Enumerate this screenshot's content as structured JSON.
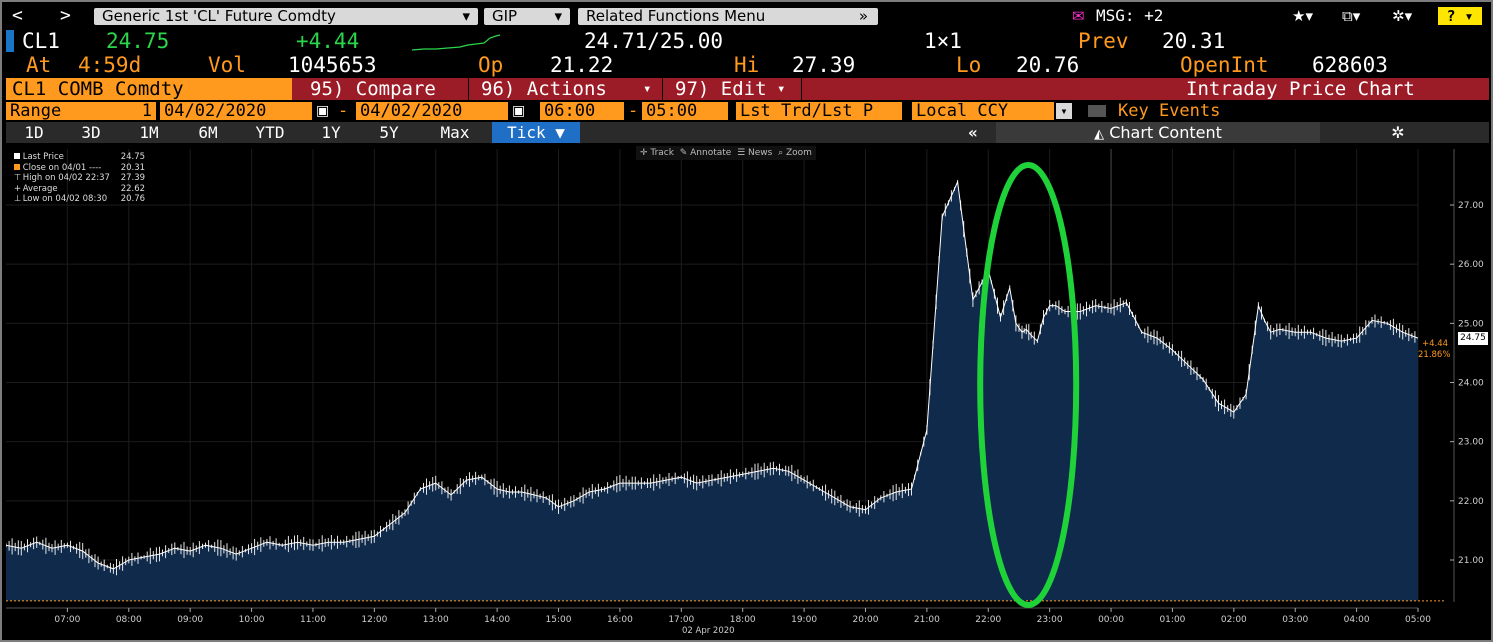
{
  "topbar": {
    "back": "<",
    "forward": ">",
    "security_menu": "Generic 1st 'CL' Future Comdty",
    "gip_menu": "GIP",
    "related_menu": "Related Functions Menu",
    "msg": "MSG: +2",
    "help": "?"
  },
  "quote": {
    "ticker": "CL1",
    "last": "24.75",
    "change": "+4.44",
    "bid_ask": "24.71/25.00",
    "size": "1×1",
    "prev_label": "Prev",
    "prev": "20.31",
    "at_label": "At",
    "at_time": "4:59d",
    "vol_label": "Vol",
    "vol": "1045653",
    "op_label": "Op",
    "op": "21.22",
    "hi_label": "Hi",
    "hi": "27.39",
    "lo_label": "Lo",
    "lo": "20.76",
    "oi_label": "OpenInt",
    "oi": "628603"
  },
  "redbar": {
    "security": "CL1 COMB Comdty",
    "compare": "95) Compare",
    "actions": "96) Actions",
    "edit": "97) Edit",
    "title": "Intraday Price Chart"
  },
  "rangebar": {
    "range_label": "Range",
    "range_value": "1",
    "start_date": "04/02/2020",
    "end_date": "04/02/2020",
    "start_time": "06:00",
    "end_time": "05:00",
    "price_type": "Lst Trd/Lst P",
    "currency": "Local CCY",
    "key_events": "Key Events"
  },
  "periods": [
    "1D",
    "3D",
    "1M",
    "6M",
    "YTD",
    "1Y",
    "5Y",
    "Max"
  ],
  "tick_label": "Tick",
  "chart_content": "Chart Content",
  "toolbar": {
    "track": "Track",
    "annotate": "Annotate",
    "news": "News",
    "zoom": "Zoom"
  },
  "legend": [
    {
      "label": "Last Price",
      "value": "24.75",
      "color": "#ffffff"
    },
    {
      "label": "Close on 04/01 ----",
      "value": "20.31",
      "color": "#ff9a1f"
    },
    {
      "label": "High on 04/02 22:37",
      "value": "27.39",
      "color": "#cfcfcf"
    },
    {
      "label": "Average",
      "value": "22.62",
      "color": "#cfcfcf"
    },
    {
      "label": "Low on 04/02 08:30",
      "value": "20.76",
      "color": "#cfcfcf"
    }
  ],
  "price_tag": {
    "last": "24.75",
    "change": "+4.44",
    "pct": "21.86%"
  },
  "x_date_label": "02 Apr 2020",
  "colors": {
    "orange": "#ff9a1f",
    "green": "#2bd64b",
    "redbar": "#9b1b26",
    "area": "#0f2a4a",
    "highlight": "#1fd23a"
  },
  "chart_data": {
    "type": "area",
    "title": "Intraday Price Chart",
    "xlabel": "02 Apr 2020",
    "ylabel": "",
    "x_ticks": [
      "07:00",
      "08:00",
      "09:00",
      "10:00",
      "11:00",
      "12:00",
      "13:00",
      "14:00",
      "15:00",
      "16:00",
      "17:00",
      "18:00",
      "19:00",
      "20:00",
      "21:00",
      "22:00",
      "23:00",
      "00:00",
      "01:00",
      "02:00",
      "03:00",
      "04:00",
      "05:00"
    ],
    "y_ticks": [
      "21.00",
      "22.00",
      "23.00",
      "24.00",
      "25.00",
      "26.00",
      "27.00"
    ],
    "ylim": [
      20.31,
      27.6
    ],
    "reference_line": 20.31,
    "series": [
      {
        "name": "Last Price",
        "x": [
          6.0,
          6.25,
          6.5,
          6.75,
          7.0,
          7.25,
          7.5,
          7.75,
          8.0,
          8.25,
          8.5,
          8.75,
          9.0,
          9.25,
          9.5,
          9.75,
          10.0,
          10.25,
          10.5,
          10.75,
          11.0,
          11.25,
          11.5,
          11.75,
          12.0,
          12.25,
          12.5,
          12.75,
          13.0,
          13.25,
          13.5,
          13.75,
          14.0,
          14.2,
          14.4,
          14.6,
          14.8,
          15.0,
          15.25,
          15.5,
          15.75,
          16.0,
          16.25,
          16.5,
          16.75,
          17.0,
          17.25,
          17.5,
          17.75,
          18.0,
          18.25,
          18.5,
          18.75,
          19.0,
          19.25,
          19.5,
          19.75,
          20.0,
          20.25,
          20.5,
          20.75,
          21.0,
          21.25,
          21.5,
          21.75,
          22.0,
          22.2,
          22.35,
          22.45,
          22.55,
          22.62,
          22.7,
          22.8,
          22.9,
          23.0,
          23.1,
          23.25,
          23.5,
          23.75,
          24.0,
          24.25,
          24.5,
          24.75,
          25.0,
          25.25,
          25.5,
          25.75,
          26.0,
          26.2,
          26.4,
          26.5,
          26.6,
          26.75,
          27.0,
          27.25,
          27.5,
          27.75,
          28.0,
          28.25,
          28.5,
          28.75,
          29.0
        ],
        "values": [
          21.25,
          21.2,
          21.3,
          21.2,
          21.25,
          21.15,
          20.95,
          20.85,
          21.0,
          21.05,
          21.1,
          21.2,
          21.15,
          21.25,
          21.2,
          21.1,
          21.2,
          21.3,
          21.25,
          21.3,
          21.25,
          21.3,
          21.3,
          21.35,
          21.4,
          21.6,
          21.8,
          22.2,
          22.3,
          22.1,
          22.35,
          22.4,
          22.2,
          22.15,
          22.15,
          22.1,
          22.05,
          21.9,
          22.0,
          22.15,
          22.2,
          22.3,
          22.3,
          22.3,
          22.35,
          22.4,
          22.3,
          22.35,
          22.4,
          22.45,
          22.5,
          22.55,
          22.5,
          22.35,
          22.2,
          22.05,
          21.9,
          21.85,
          22.05,
          22.15,
          22.2,
          23.2,
          26.8,
          27.39,
          25.4,
          25.9,
          25.1,
          25.6,
          25.0,
          24.85,
          24.9,
          24.8,
          24.7,
          25.1,
          25.3,
          25.3,
          25.2,
          25.2,
          25.3,
          25.25,
          25.35,
          24.85,
          24.75,
          24.55,
          24.3,
          24.05,
          23.65,
          23.5,
          23.8,
          25.3,
          25.05,
          24.85,
          24.9,
          24.85,
          24.85,
          24.75,
          24.7,
          24.75,
          25.05,
          25.0,
          24.85,
          24.75
        ]
      }
    ]
  }
}
